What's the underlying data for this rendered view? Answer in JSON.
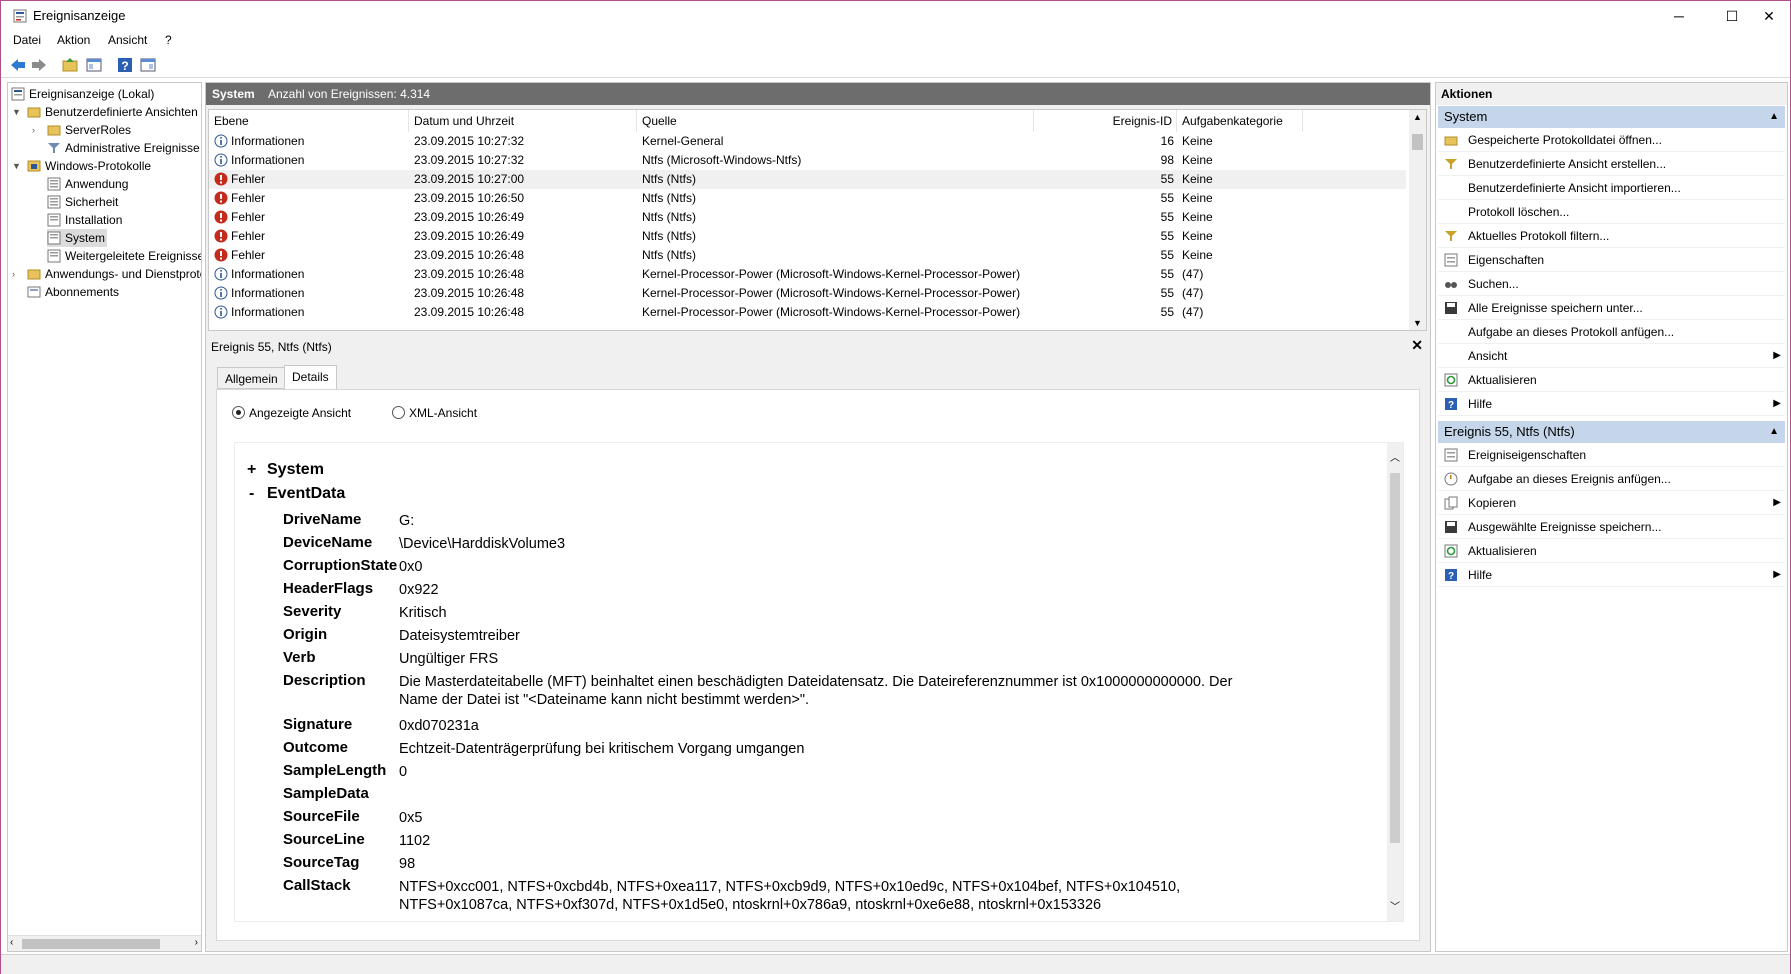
{
  "window": {
    "title": "Ereignisanzeige"
  },
  "menu": [
    "Datei",
    "Aktion",
    "Ansicht",
    "?"
  ],
  "tree": {
    "root": "Ereignisanzeige (Lokal)",
    "custom_views": "Benutzerdefinierte Ansichten",
    "server_roles": "ServerRoles",
    "admin_events": "Administrative Ereignisse",
    "windows_logs": "Windows-Protokolle",
    "app": "Anwendung",
    "security": "Sicherheit",
    "installation": "Installation",
    "system": "System",
    "forwarded": "Weitergeleitete Ereignisse",
    "apps_services": "Anwendungs- und Dienstprotokolle",
    "subscriptions": "Abonnements"
  },
  "log_header": {
    "name": "System",
    "count_text": "Anzahl von Ereignissen: 4.314"
  },
  "columns": [
    "Ebene",
    "Datum und Uhrzeit",
    "Quelle",
    "Ereignis-ID",
    "Aufgabenkategorie"
  ],
  "events": [
    {
      "level": "Informationen",
      "type": "info",
      "date": "23.09.2015 10:27:32",
      "source": "Kernel-General",
      "id": "16",
      "cat": "Keine"
    },
    {
      "level": "Informationen",
      "type": "info",
      "date": "23.09.2015 10:27:32",
      "source": "Ntfs (Microsoft-Windows-Ntfs)",
      "id": "98",
      "cat": "Keine"
    },
    {
      "level": "Fehler",
      "type": "error",
      "date": "23.09.2015 10:27:00",
      "source": "Ntfs (Ntfs)",
      "id": "55",
      "cat": "Keine"
    },
    {
      "level": "Fehler",
      "type": "error",
      "date": "23.09.2015 10:26:50",
      "source": "Ntfs (Ntfs)",
      "id": "55",
      "cat": "Keine"
    },
    {
      "level": "Fehler",
      "type": "error",
      "date": "23.09.2015 10:26:49",
      "source": "Ntfs (Ntfs)",
      "id": "55",
      "cat": "Keine"
    },
    {
      "level": "Fehler",
      "type": "error",
      "date": "23.09.2015 10:26:49",
      "source": "Ntfs (Ntfs)",
      "id": "55",
      "cat": "Keine"
    },
    {
      "level": "Fehler",
      "type": "error",
      "date": "23.09.2015 10:26:48",
      "source": "Ntfs (Ntfs)",
      "id": "55",
      "cat": "Keine"
    },
    {
      "level": "Informationen",
      "type": "info",
      "date": "23.09.2015 10:26:48",
      "source": "Kernel-Processor-Power (Microsoft-Windows-Kernel-Processor-Power)",
      "id": "55",
      "cat": "(47)"
    },
    {
      "level": "Informationen",
      "type": "info",
      "date": "23.09.2015 10:26:48",
      "source": "Kernel-Processor-Power (Microsoft-Windows-Kernel-Processor-Power)",
      "id": "55",
      "cat": "(47)"
    },
    {
      "level": "Informationen",
      "type": "info",
      "date": "23.09.2015 10:26:48",
      "source": "Kernel-Processor-Power (Microsoft-Windows-Kernel-Processor-Power)",
      "id": "55",
      "cat": "(47)"
    }
  ],
  "detail": {
    "title": "Ereignis 55, Ntfs (Ntfs)",
    "tabs": [
      "Allgemein",
      "Details"
    ],
    "view_options": [
      "Angezeigte Ansicht",
      "XML-Ansicht"
    ],
    "sections": {
      "system": "System",
      "eventdata": "EventData",
      "plus": "+",
      "minus": "-"
    },
    "fields": [
      {
        "k": "DriveName",
        "v": "G:"
      },
      {
        "k": "DeviceName",
        "v": "\\Device\\HarddiskVolume3"
      },
      {
        "k": "CorruptionState",
        "v": "0x0"
      },
      {
        "k": "HeaderFlags",
        "v": "0x922"
      },
      {
        "k": "Severity",
        "v": "Kritisch"
      },
      {
        "k": "Origin",
        "v": "Dateisystemtreiber"
      },
      {
        "k": "Verb",
        "v": "Ungültiger FRS"
      },
      {
        "k": "Description",
        "v": "Die Masterdateitabelle (MFT) beinhaltet einen beschädigten Dateidatensatz. Die Dateireferenznummer ist 0x1000000000000. Der Name der Datei ist \"<Dateiname kann nicht bestimmt werden>\"."
      },
      {
        "k": "Signature",
        "v": "0xd070231a"
      },
      {
        "k": "Outcome",
        "v": "Echtzeit-Datenträgerprüfung bei kritischem Vorgang umgangen"
      },
      {
        "k": "SampleLength",
        "v": "0"
      },
      {
        "k": "SampleData",
        "v": ""
      },
      {
        "k": "SourceFile",
        "v": "0x5"
      },
      {
        "k": "SourceLine",
        "v": "1102"
      },
      {
        "k": "SourceTag",
        "v": "98"
      },
      {
        "k": "CallStack",
        "v": "NTFS+0xcc001, NTFS+0xcbd4b, NTFS+0xea117, NTFS+0xcb9d9, NTFS+0x10ed9c, NTFS+0x104bef, NTFS+0x104510, NTFS+0x1087ca, NTFS+0xf307d, NTFS+0x1d5e0, ntoskrnl+0x786a9, ntoskrnl+0xe6e88, ntoskrnl+0x153326"
      }
    ]
  },
  "actions": {
    "header": "Aktionen",
    "group1": "System",
    "group1_items": [
      {
        "label": "Gespeicherte Protokolldatei öffnen...",
        "icon": "folder-open-icon"
      },
      {
        "label": "Benutzerdefinierte Ansicht erstellen...",
        "icon": "filter-icon"
      },
      {
        "label": "Benutzerdefinierte Ansicht importieren...",
        "icon": ""
      },
      {
        "label": "Protokoll löschen...",
        "icon": ""
      },
      {
        "label": "Aktuelles Protokoll filtern...",
        "icon": "filter-icon"
      },
      {
        "label": "Eigenschaften",
        "icon": "properties-icon"
      },
      {
        "label": "Suchen...",
        "icon": "binoculars-icon"
      },
      {
        "label": "Alle Ereignisse speichern unter...",
        "icon": "save-icon"
      },
      {
        "label": "Aufgabe an dieses Protokoll anfügen...",
        "icon": ""
      },
      {
        "label": "Ansicht",
        "icon": "",
        "sub": true
      },
      {
        "label": "Aktualisieren",
        "icon": "refresh-icon"
      },
      {
        "label": "Hilfe",
        "icon": "help-icon",
        "sub": true
      }
    ],
    "group2": "Ereignis 55, Ntfs (Ntfs)",
    "group2_items": [
      {
        "label": "Ereigniseigenschaften",
        "icon": "properties-icon"
      },
      {
        "label": "Aufgabe an dieses Ereignis anfügen...",
        "icon": "task-icon"
      },
      {
        "label": "Kopieren",
        "icon": "copy-icon",
        "sub": true
      },
      {
        "label": "Ausgewählte Ereignisse speichern...",
        "icon": "save-icon"
      },
      {
        "label": "Aktualisieren",
        "icon": "refresh-icon"
      },
      {
        "label": "Hilfe",
        "icon": "help-icon",
        "sub": true
      }
    ]
  },
  "colors": {
    "group_header": "#c5d6ea",
    "log_header": "#6d6d6d",
    "error": "#c42b1c",
    "info": "#2b5797"
  }
}
